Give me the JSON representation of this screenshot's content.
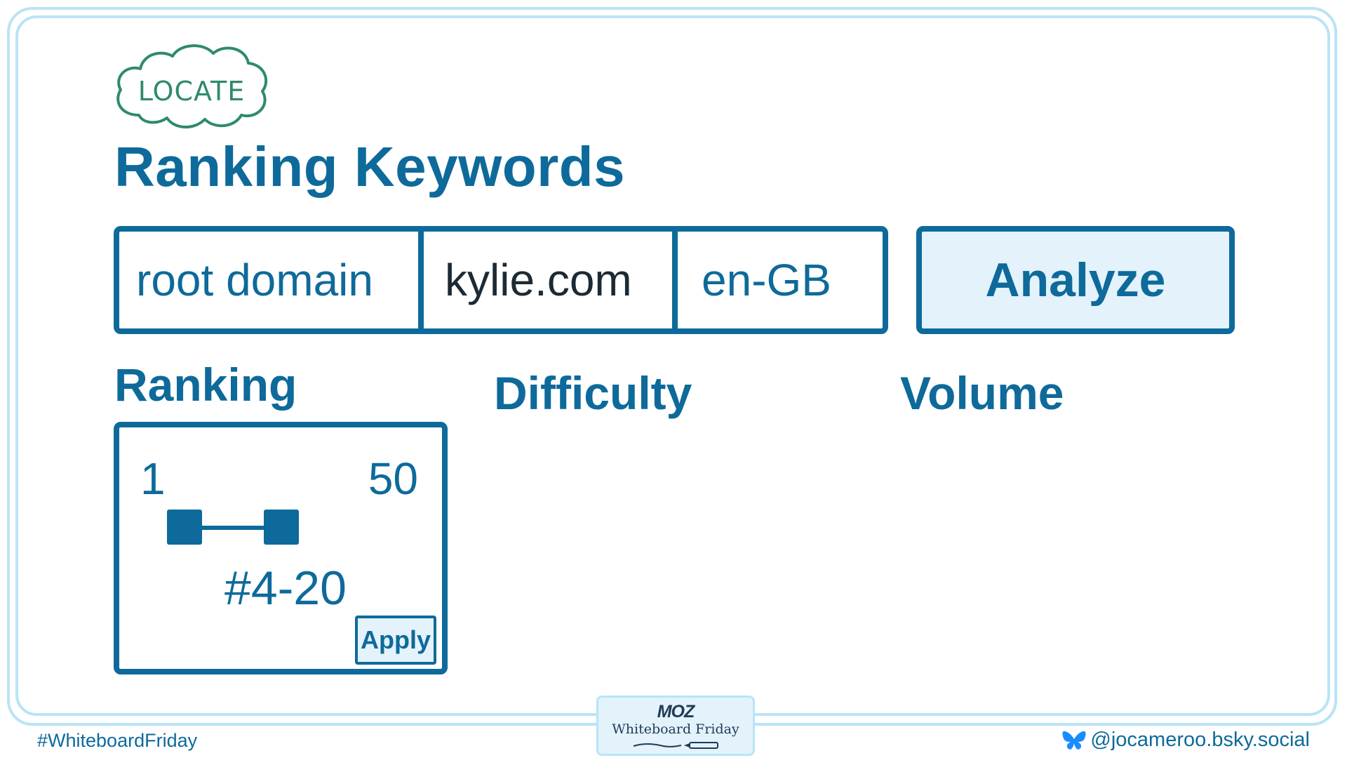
{
  "badge": {
    "label": "LOCATE"
  },
  "page": {
    "title": "Ranking Keywords"
  },
  "search": {
    "type_value": "root domain",
    "domain_value": "kylie.com",
    "locale_value": "en-GB",
    "analyze_label": "Analyze"
  },
  "filters": {
    "ranking_label": "Ranking",
    "difficulty_label": "Difficulty",
    "volume_label": "Volume",
    "ranking": {
      "min_label": "1",
      "max_label": "50",
      "selected_range": "#4-20",
      "apply_label": "Apply"
    }
  },
  "footer": {
    "hashtag": "#WhiteboardFriday",
    "brand_logo": "MOZ",
    "brand_name": "Whiteboard Friday",
    "social_handle": "@jocameroo.bsky.social"
  },
  "colors": {
    "primary": "#0e6a9a",
    "frame": "#b9e4f5",
    "button_fill": "#e3f2fb",
    "badge_green": "#2e8a6e",
    "text_dark": "#1d2a33"
  },
  "icons": {
    "badge_shape": "cloud-icon",
    "social": "butterfly-icon"
  }
}
